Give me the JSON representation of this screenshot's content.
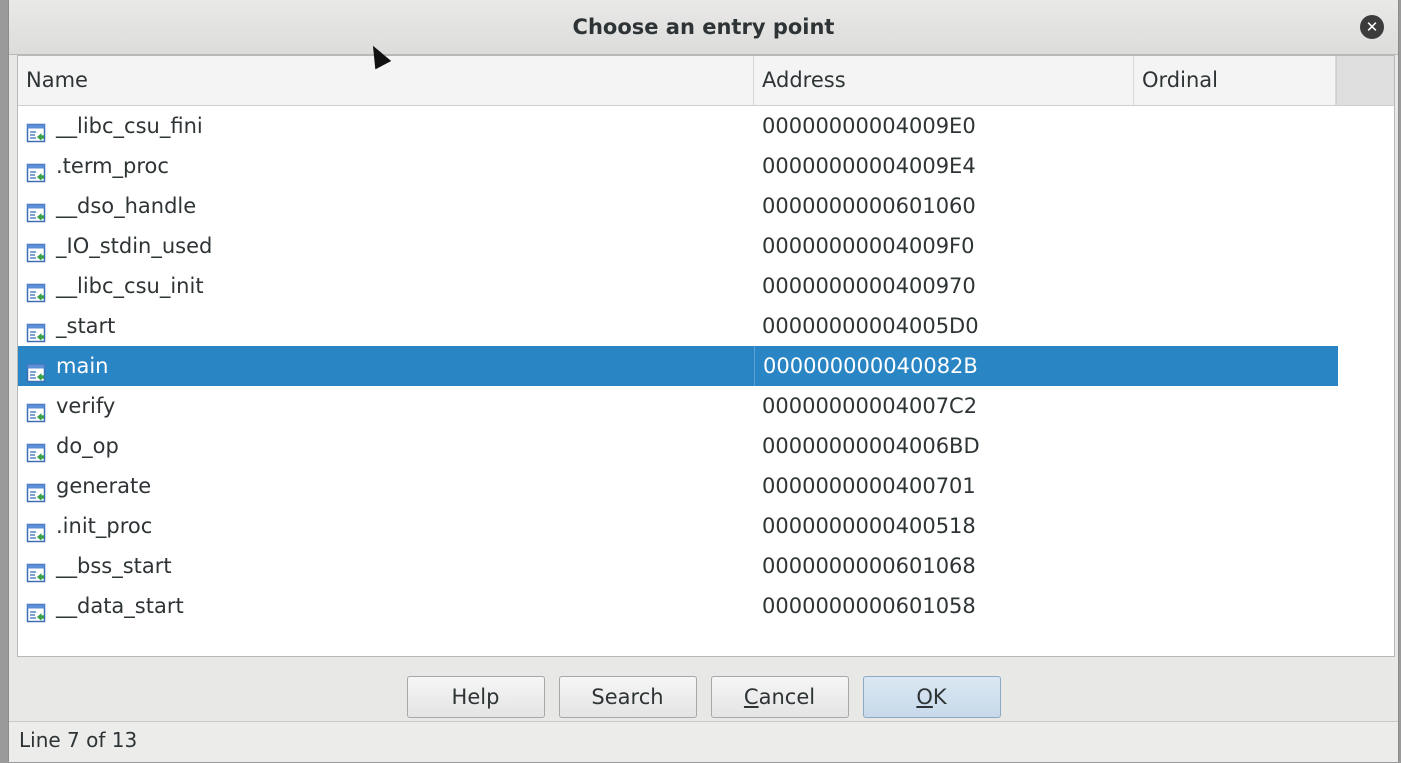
{
  "dialog": {
    "title": "Choose an entry point",
    "close_icon": "close-icon"
  },
  "table": {
    "columns": [
      "Name",
      "Address",
      "Ordinal"
    ],
    "rows": [
      {
        "name": "__libc_csu_fini",
        "address": "00000000004009E0",
        "ordinal": ""
      },
      {
        "name": ".term_proc",
        "address": "00000000004009E4",
        "ordinal": ""
      },
      {
        "name": "__dso_handle",
        "address": "0000000000601060",
        "ordinal": ""
      },
      {
        "name": "_IO_stdin_used",
        "address": "00000000004009F0",
        "ordinal": ""
      },
      {
        "name": "__libc_csu_init",
        "address": "0000000000400970",
        "ordinal": ""
      },
      {
        "name": "_start",
        "address": "00000000004005D0",
        "ordinal": ""
      },
      {
        "name": "main",
        "address": "000000000040082B",
        "ordinal": ""
      },
      {
        "name": "verify",
        "address": "00000000004007C2",
        "ordinal": ""
      },
      {
        "name": "do_op",
        "address": "00000000004006BD",
        "ordinal": ""
      },
      {
        "name": "generate",
        "address": "0000000000400701",
        "ordinal": ""
      },
      {
        "name": ".init_proc",
        "address": "0000000000400518",
        "ordinal": ""
      },
      {
        "name": "__bss_start",
        "address": "0000000000601068",
        "ordinal": ""
      },
      {
        "name": "__data_start",
        "address": "0000000000601058",
        "ordinal": ""
      }
    ],
    "selected_index": 6,
    "row_icon": "function-icon"
  },
  "buttons": {
    "help": "Help",
    "search": "Search",
    "cancel_prefix": "",
    "cancel_accel": "C",
    "cancel_rest": "ancel",
    "ok_accel": "O",
    "ok_rest": "K"
  },
  "status": {
    "text": "Line 7 of 13"
  },
  "colors": {
    "selection": "#2a85c5",
    "accent_primary_button": "#c7d9ea"
  }
}
